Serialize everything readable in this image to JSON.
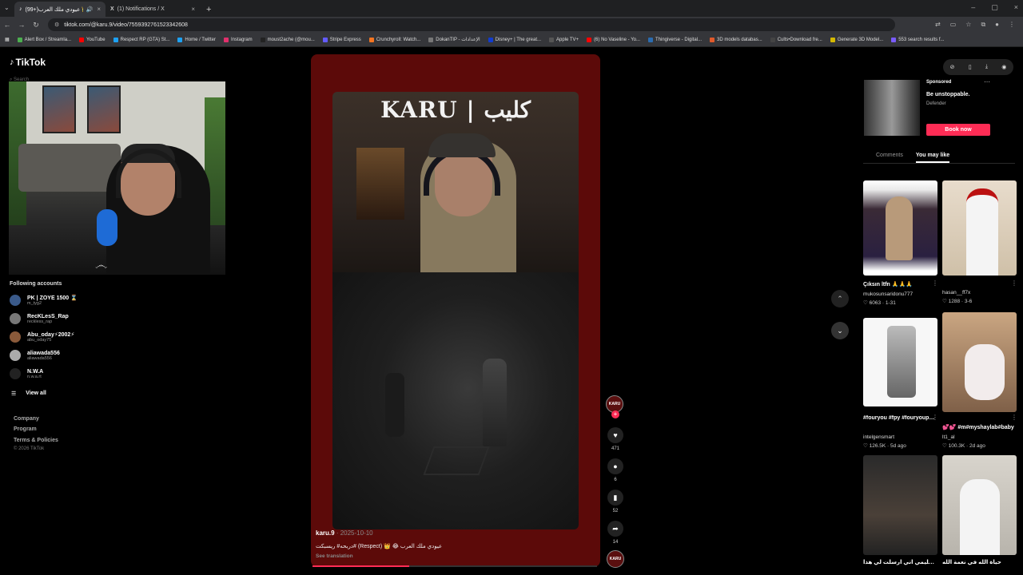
{
  "browser": {
    "tabs": [
      {
        "title": "(99+)عيودي ملك العرب 👑",
        "active": true
      },
      {
        "title": "(1) Notifications / X",
        "active": false
      }
    ],
    "url": "tiktok.com/@karu.9/video/7559392761523342608",
    "bookmarks": [
      "Alert Box / Streamla...",
      "YouTube",
      "Respect RP (GTA) St...",
      "Home / Twitter",
      "Instagram",
      "moust2ache (@mou...",
      "Stripe Express",
      "Crunchyroll: Watch...",
      "DokanTIP - الإعدادات",
      "Disney+ | The great...",
      "Apple TV+",
      "(6) No Vaseline - Yo...",
      "Thingiverse - Digital...",
      "3D models databas...",
      "Cults•Download fre...",
      "Generate 3D Model...",
      "553 search results f..."
    ]
  },
  "sidebar": {
    "logo": "TikTok",
    "search_placeholder": "Search",
    "following_title": "Following accounts",
    "accounts": [
      {
        "name": "PK | ZOYE 1500 ⌛",
        "handle": "m_tyg2"
      },
      {
        "name": "RecKLesS_Rap",
        "handle": "reckless_rap"
      },
      {
        "name": "Abu_oday⚡2002⚡",
        "handle": "abu_oday75"
      },
      {
        "name": "aliawada556",
        "handle": "aliawada556"
      },
      {
        "name": "N.W.A",
        "handle": "n.w.a.rt"
      }
    ],
    "view_all": "View all",
    "footer": [
      "Company",
      "Program",
      "Terms & Policies"
    ],
    "copyright": "© 2026 TikTok"
  },
  "video": {
    "overlay_title": "KARU | كليب",
    "username": "karu.9",
    "date": "2025-10-10",
    "caption": "دربحه# ريسبكت# (Respect) 👑 😂 عيودي ملك العرب",
    "see_translation": "See translation",
    "progress": 0.34,
    "avatar_text": "KARU",
    "likes": "471",
    "comments": "6",
    "saves": "52",
    "shares": "14"
  },
  "right_panel": {
    "ad": {
      "label": "Sponsored",
      "title": "Be unstoppable.",
      "brand": "Defender",
      "cta": "Book now"
    },
    "tabs": [
      "Comments",
      "You may like"
    ],
    "active_tab": "You may like",
    "videos": [
      {
        "title": "Çıksın ltfn 🙏🙏🙏",
        "user": "mukosunsaridonu777",
        "stats": "♡ 6063 · 1-31"
      },
      {
        "title": "",
        "user": "hasan__ff7x",
        "stats": "♡ 1288 · 3-6"
      },
      {
        "title": "#fouryou #fpy #fouryoupage #CapC...",
        "user": "intelgensmart",
        "stats": "♡ 126.5K · 5d ago"
      },
      {
        "title": "💕💕 #m#myshaylab#baby",
        "user": "lt1_al",
        "stats": "♡ 100.3K · 2d ago"
      },
      {
        "title": "مو عليمي اني ارسلت لي هذا",
        "user": "",
        "stats": ""
      },
      {
        "title": "حياة الله في نعمة الله",
        "user": "",
        "stats": ""
      }
    ]
  },
  "colors": {
    "accent": "#fe2c55",
    "video_bg": "#5c0a09"
  }
}
